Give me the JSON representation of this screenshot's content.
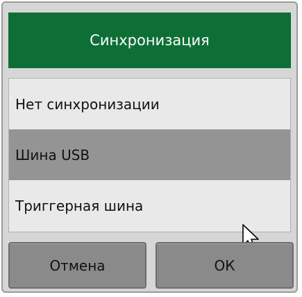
{
  "dialog": {
    "title": "Синхронизация",
    "options": [
      {
        "label": "Нет синхронизации",
        "selected": false
      },
      {
        "label": "Шина USB",
        "selected": true
      },
      {
        "label": "Триггерная шина",
        "selected": false
      }
    ],
    "buttons": {
      "cancel_label": "Отмена",
      "ok_label": "ОК"
    }
  },
  "colors": {
    "title_bg": "#0e6f36",
    "selected_bg": "#949494",
    "button_bg": "#8a8a8a"
  },
  "icons": {
    "cursor": "mouse-pointer-icon"
  }
}
